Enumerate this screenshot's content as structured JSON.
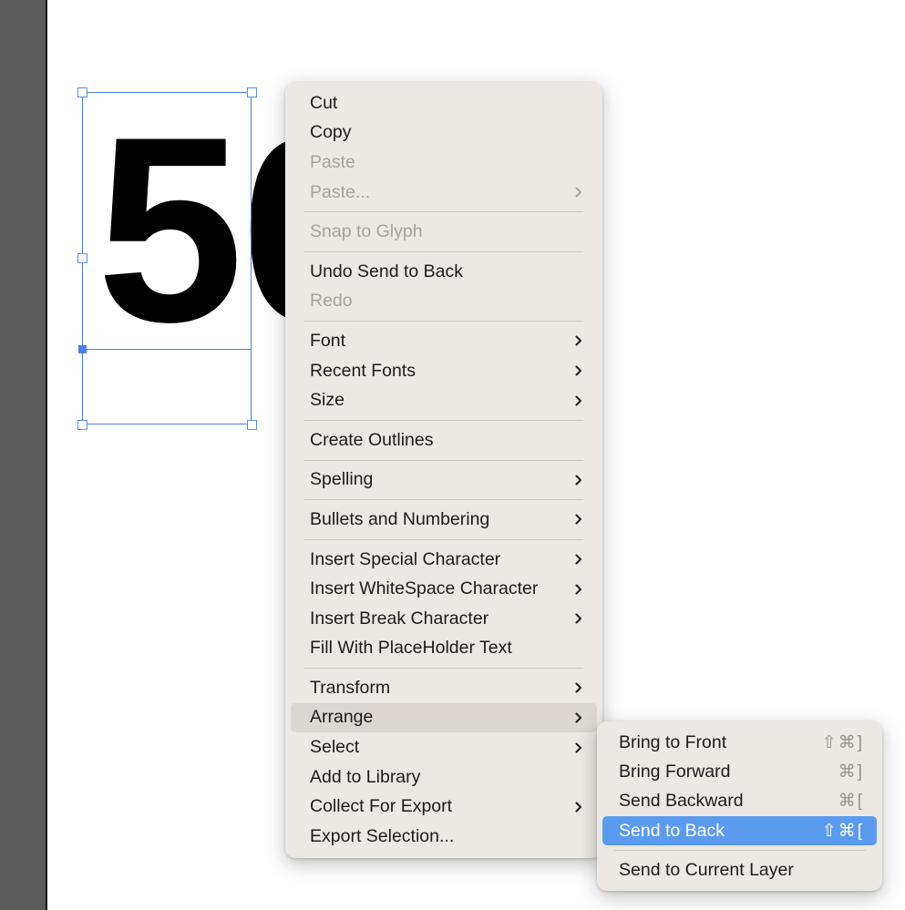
{
  "app": {
    "canvas": {
      "artwork_text": "50",
      "selection": {
        "handle_count": 5,
        "anchor_label": "baseline-anchor"
      }
    },
    "theme": {
      "menu_bg": "#ece8e4",
      "menu_text": "#1c1c1c",
      "menu_disabled_text": "#a9a19d",
      "highlight_gray": "#dcd7d2",
      "highlight_blue": "#5a9bf0",
      "selection_blue": "#4a7fe8",
      "toolbar_gray": "#5b5b5b",
      "separator": "#cdc7c2",
      "shortcut_text": "#9a9290"
    }
  },
  "context_menu": {
    "name": "object-context-menu",
    "groups": [
      {
        "items": [
          {
            "label": "Cut",
            "enabled": true,
            "submenu": false,
            "shortcut": ""
          },
          {
            "label": "Copy",
            "enabled": true,
            "submenu": false,
            "shortcut": ""
          },
          {
            "label": "Paste",
            "enabled": false,
            "submenu": false,
            "shortcut": ""
          },
          {
            "label": "Paste...",
            "enabled": false,
            "submenu": true,
            "shortcut": ""
          }
        ]
      },
      {
        "items": [
          {
            "label": "Snap to Glyph",
            "enabled": false,
            "submenu": false,
            "shortcut": ""
          }
        ]
      },
      {
        "items": [
          {
            "label": "Undo Send to Back",
            "enabled": true,
            "submenu": false,
            "shortcut": ""
          },
          {
            "label": "Redo",
            "enabled": false,
            "submenu": false,
            "shortcut": ""
          }
        ]
      },
      {
        "items": [
          {
            "label": "Font",
            "enabled": true,
            "submenu": true,
            "shortcut": ""
          },
          {
            "label": "Recent Fonts",
            "enabled": true,
            "submenu": true,
            "shortcut": ""
          },
          {
            "label": "Size",
            "enabled": true,
            "submenu": true,
            "shortcut": ""
          }
        ]
      },
      {
        "items": [
          {
            "label": "Create Outlines",
            "enabled": true,
            "submenu": false,
            "shortcut": ""
          }
        ]
      },
      {
        "items": [
          {
            "label": "Spelling",
            "enabled": true,
            "submenu": true,
            "shortcut": ""
          }
        ]
      },
      {
        "items": [
          {
            "label": "Bullets and Numbering",
            "enabled": true,
            "submenu": true,
            "shortcut": ""
          }
        ]
      },
      {
        "items": [
          {
            "label": "Insert Special Character",
            "enabled": true,
            "submenu": true,
            "shortcut": ""
          },
          {
            "label": "Insert WhiteSpace Character",
            "enabled": true,
            "submenu": true,
            "shortcut": ""
          },
          {
            "label": "Insert Break Character",
            "enabled": true,
            "submenu": true,
            "shortcut": ""
          },
          {
            "label": "Fill With PlaceHolder Text",
            "enabled": true,
            "submenu": false,
            "shortcut": ""
          }
        ]
      },
      {
        "items": [
          {
            "label": "Transform",
            "enabled": true,
            "submenu": true,
            "shortcut": ""
          },
          {
            "label": "Arrange",
            "enabled": true,
            "submenu": true,
            "shortcut": "",
            "highlight": "gray"
          },
          {
            "label": "Select",
            "enabled": true,
            "submenu": true,
            "shortcut": ""
          },
          {
            "label": "Add to Library",
            "enabled": true,
            "submenu": false,
            "shortcut": ""
          },
          {
            "label": "Collect For Export",
            "enabled": true,
            "submenu": true,
            "shortcut": ""
          },
          {
            "label": "Export Selection...",
            "enabled": true,
            "submenu": false,
            "shortcut": ""
          }
        ]
      }
    ]
  },
  "arrange_submenu": {
    "name": "arrange-submenu",
    "groups": [
      {
        "items": [
          {
            "label": "Bring to Front",
            "enabled": true,
            "submenu": false,
            "shortcut": "⇧⌘]"
          },
          {
            "label": "Bring Forward",
            "enabled": true,
            "submenu": false,
            "shortcut": "⌘]"
          },
          {
            "label": "Send Backward",
            "enabled": true,
            "submenu": false,
            "shortcut": "⌘["
          },
          {
            "label": "Send to Back",
            "enabled": true,
            "submenu": false,
            "shortcut": "⇧⌘[",
            "highlight": "blue"
          }
        ]
      },
      {
        "items": [
          {
            "label": "Send to Current Layer",
            "enabled": true,
            "submenu": false,
            "shortcut": ""
          }
        ]
      }
    ]
  }
}
